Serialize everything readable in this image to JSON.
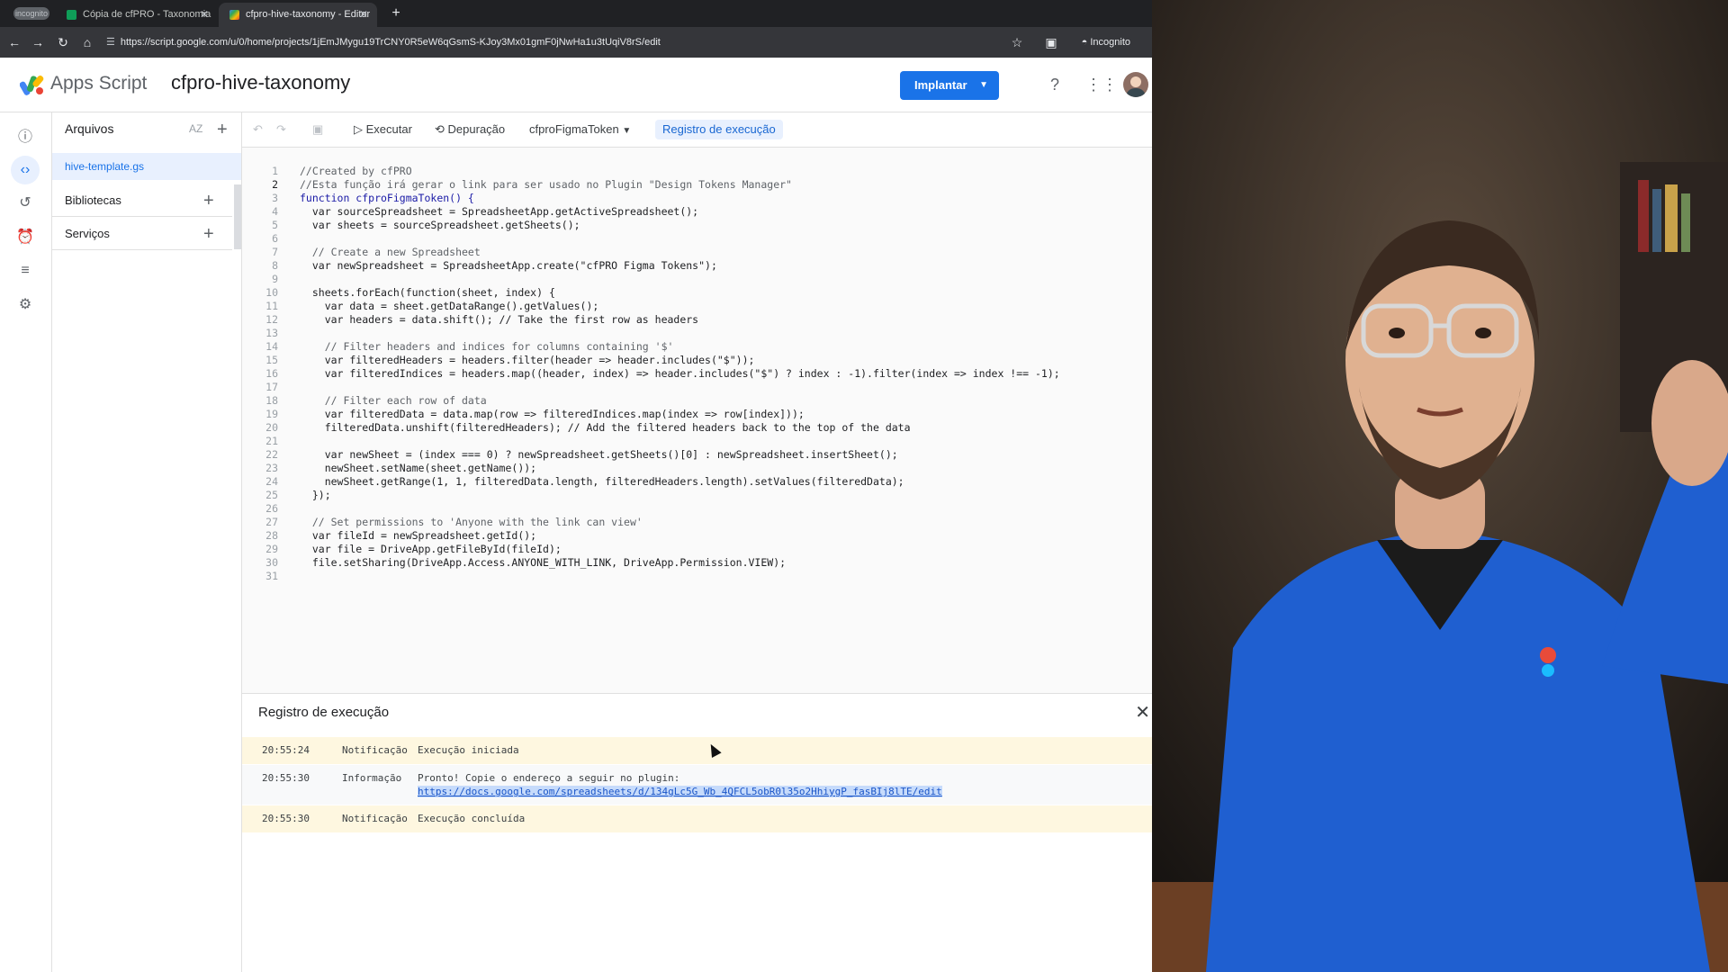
{
  "browser": {
    "incognito_badge": "incognito",
    "tabs": [
      {
        "title": "Cópia de cfPRO - Taxonomia"
      },
      {
        "title": "cfpro-hive-taxonomy - Editor"
      }
    ],
    "url": "https://script.google.com/u/0/home/projects/1jEmJMygu19TrCNY0R5eW6qGsmS-KJoy3Mx01gmF0jNwHa1u3tUqiV8rS/edit",
    "incognito_label": "Incognito"
  },
  "header": {
    "app_name": "Apps Script",
    "project_name": "cfpro-hive-taxonomy",
    "deploy_label": "Implantar"
  },
  "files_panel": {
    "title": "Arquivos",
    "sort_label": "AZ",
    "active_file": "hive-template.gs",
    "libraries_label": "Bibliotecas",
    "services_label": "Serviços"
  },
  "toolbar": {
    "run_label": "Executar",
    "debug_label": "Depuração",
    "function_name": "cfproFigmaToken",
    "execution_log_label": "Registro de execução"
  },
  "code_lines": [
    "1",
    "2",
    "3",
    "4",
    "5",
    "6",
    "7",
    "8",
    "9",
    "10",
    "11",
    "12",
    "13",
    "14",
    "15",
    "16",
    "17",
    "18",
    "19",
    "20",
    "21",
    "22",
    "23",
    "24",
    "25",
    "26",
    "27",
    "28",
    "29",
    "30",
    "31"
  ],
  "code": {
    "l1": "//Created by cfPRO",
    "l2": "//Esta função irá gerar o link para ser usado no Plugin \"Design Tokens Manager\"",
    "l3": "function cfproFigmaToken() {",
    "l4": "  var sourceSpreadsheet = SpreadsheetApp.getActiveSpreadsheet();",
    "l5": "  var sheets = sourceSpreadsheet.getSheets();",
    "l7": "  // Create a new Spreadsheet",
    "l8": "  var newSpreadsheet = SpreadsheetApp.create(\"cfPRO Figma Tokens\");",
    "l10": "  sheets.forEach(function(sheet, index) {",
    "l11": "    var data = sheet.getDataRange().getValues();",
    "l12": "    var headers = data.shift(); // Take the first row as headers",
    "l14": "    // Filter headers and indices for columns containing '$'",
    "l15": "    var filteredHeaders = headers.filter(header => header.includes(\"$\"));",
    "l16": "    var filteredIndices = headers.map((header, index) => header.includes(\"$\") ? index : -1).filter(index => index !== -1);",
    "l18": "    // Filter each row of data",
    "l19": "    var filteredData = data.map(row => filteredIndices.map(index => row[index]));",
    "l20": "    filteredData.unshift(filteredHeaders); // Add the filtered headers back to the top of the data",
    "l22": "    var newSheet = (index === 0) ? newSpreadsheet.getSheets()[0] : newSpreadsheet.insertSheet();",
    "l23": "    newSheet.setName(sheet.getName());",
    "l24": "    newSheet.getRange(1, 1, filteredData.length, filteredHeaders.length).setValues(filteredData);",
    "l25": "  });",
    "l27": "  // Set permissions to 'Anyone with the link can view'",
    "l28": "  var fileId = newSpreadsheet.getId();",
    "l29": "  var file = DriveApp.getFileById(fileId);",
    "l30": "  file.setSharing(DriveApp.Access.ANYONE_WITH_LINK, DriveApp.Permission.VIEW);"
  },
  "execution_log": {
    "title": "Registro de execução",
    "entries": [
      {
        "time": "20:55:24",
        "level": "Notificação",
        "message": "Execução iniciada"
      },
      {
        "time": "20:55:30",
        "level": "Informação",
        "message": "Pronto! Copie o endereço a seguir no plugin:",
        "link": "https://docs.google.com/spreadsheets/d/134gLc5G_Wb_4QFCL5obR0l35o2HhiygP_fasBIj8lTE/edit"
      },
      {
        "time": "20:55:30",
        "level": "Notificação",
        "message": "Execução concluída"
      }
    ]
  },
  "colors": {
    "accent": "#1a73e8",
    "notification_bg": "#fef7e0",
    "selection": "#c6dbfb"
  }
}
